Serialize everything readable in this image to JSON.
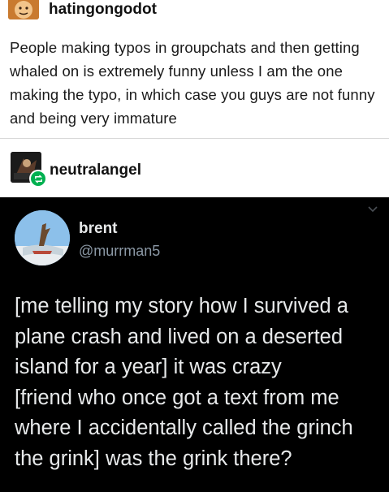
{
  "original_post": {
    "username": "hatingongodot",
    "text": "People making typos in groupchats and then getting whaled on is extremely funny unless I am the one making the typo, in which case you guys are not funny and being very immature"
  },
  "reblog": {
    "username": "neutralangel",
    "badge_icon": "reblog-icon"
  },
  "tweet": {
    "display_name": "brent",
    "handle": "@murrman5",
    "body": "[me telling my story how I survived a plane crash and lived on a deserted island for a year] it was crazy\n[friend who once got a text from me where I accidentally called the grinch the grink] was the grink there?",
    "menu_icon": "chevron-down-icon"
  },
  "colors": {
    "tweet_background": "#000000",
    "tweet_text": "#e7e9ea",
    "handle_text": "#8b98a5",
    "reblog_badge": "#00b050"
  }
}
